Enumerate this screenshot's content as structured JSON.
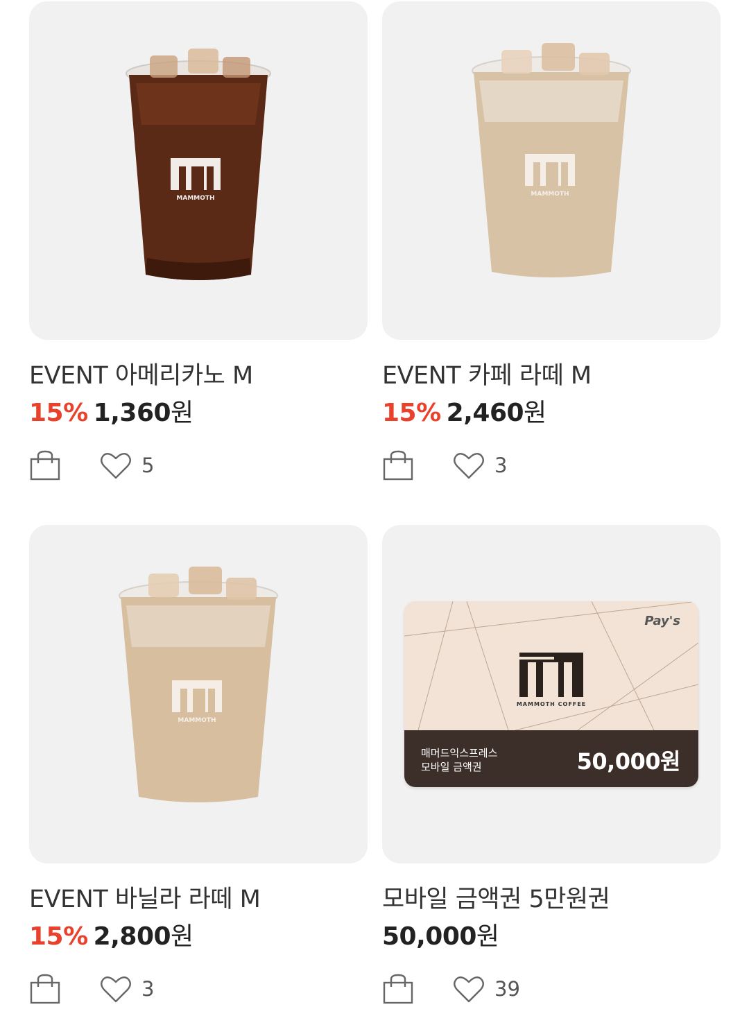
{
  "products": [
    {
      "name": "EVENT 아메리카노 M",
      "discount": "15%",
      "price": "1,360",
      "currency": "원",
      "likes": "5",
      "image": "iced-americano",
      "cup_logo": "MAMMOTH"
    },
    {
      "name": "EVENT 카페 라떼 M",
      "discount": "15%",
      "price": "2,460",
      "currency": "원",
      "likes": "3",
      "image": "iced-latte",
      "cup_logo": "MAMMOTH"
    },
    {
      "name": "EVENT 바닐라 라떼 M",
      "discount": "15%",
      "price": "2,800",
      "currency": "원",
      "likes": "3",
      "image": "iced-vanilla-latte",
      "cup_logo": "MAMMOTH"
    },
    {
      "name": "모바일 금액권 5만원권",
      "discount": "",
      "price": "50,000",
      "currency": "원",
      "likes": "39",
      "image": "gift-voucher"
    }
  ],
  "voucher": {
    "brand_badge": "Pay's",
    "brand_name": "MAMMOTH COFFEE",
    "line1": "매머드익스프레스",
    "line2": "모바일 금액권",
    "amount": "50,000원"
  },
  "colors": {
    "discount": "#e8412c",
    "thumb_bg": "#f1f1f1",
    "americano": "#5a2a17",
    "latte": "#d8c2a5",
    "voucher_bg": "#f2e3d6",
    "voucher_bottom": "#3c2f2a"
  },
  "icons": {
    "cart": "shopping-bag-icon",
    "like": "heart-icon"
  }
}
